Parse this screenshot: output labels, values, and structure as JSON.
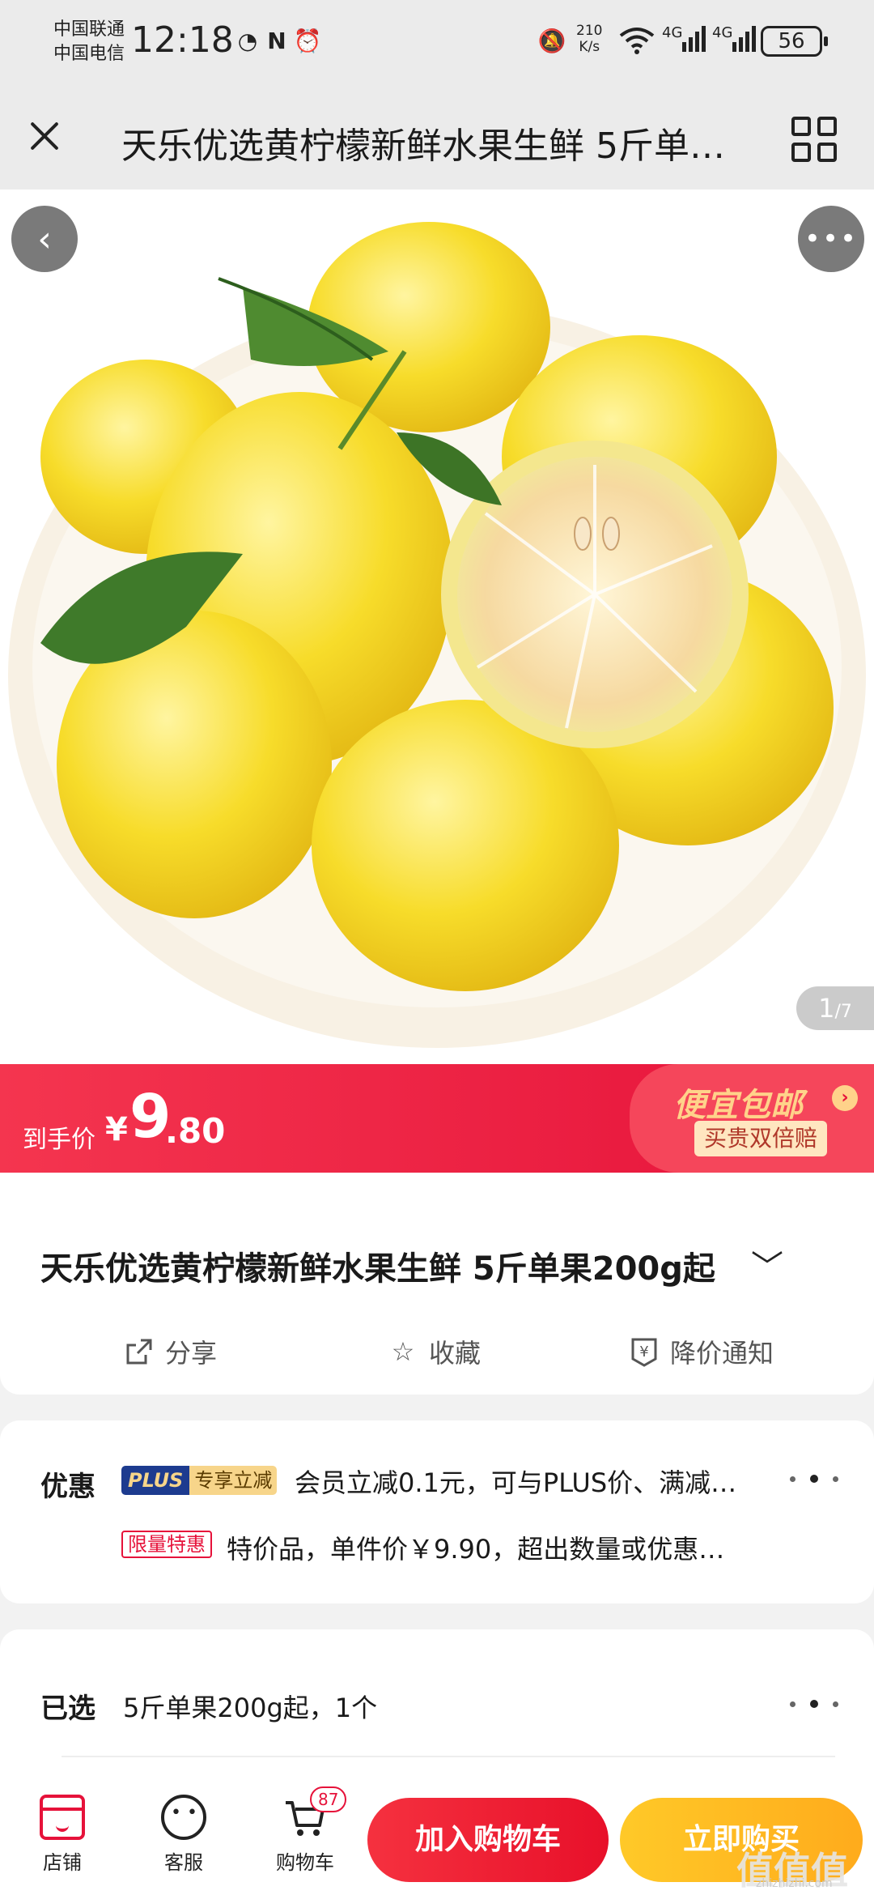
{
  "status_bar": {
    "carrier_1": "中国联通",
    "carrier_2": "中国电信",
    "time": "12:18",
    "net_speed_value": "210",
    "net_speed_unit": "K/s",
    "network_1": "4G",
    "network_2": "4G",
    "battery": "56"
  },
  "header": {
    "title": "天乐优选黄柠檬新鲜水果生鲜 5斤单…"
  },
  "gallery": {
    "current": "1",
    "total": "/7"
  },
  "price_banner": {
    "label": "到手价",
    "currency": "¥",
    "integer": "9",
    "decimal": ".80",
    "promo_title": "便宜包邮",
    "promo_badge": "买贵双倍赔",
    "colors": {
      "primary": "#e6123a",
      "accent": "#ffd28a"
    }
  },
  "product": {
    "title": "天乐优选黄柠檬新鲜水果生鲜 5斤单果200g起",
    "actions": [
      {
        "icon": "share-icon",
        "label": "分享"
      },
      {
        "icon": "star-icon",
        "label": "收藏"
      },
      {
        "icon": "price-alert-icon",
        "label": "降价通知"
      }
    ]
  },
  "promotions": {
    "label": "优惠",
    "plus_badge": "PLUS",
    "plus_badge_tag": "专享立减",
    "plus_text": "会员立减0.1元，可与PLUS价、满减…",
    "limit_badge": "限量特惠",
    "limit_text": "特价品，单件价￥9.90，超出数量或优惠…"
  },
  "selection": {
    "label": "已选",
    "value": "5斤单果200g起，1个"
  },
  "bottom_bar": {
    "shop_label": "店铺",
    "service_label": "客服",
    "cart_label": "购物车",
    "cart_count": "87",
    "add_to_cart": "加入购物车",
    "buy_now": "立即购买"
  },
  "watermark": {
    "text": "值值值",
    "sub": "zhizhizhi.com"
  }
}
